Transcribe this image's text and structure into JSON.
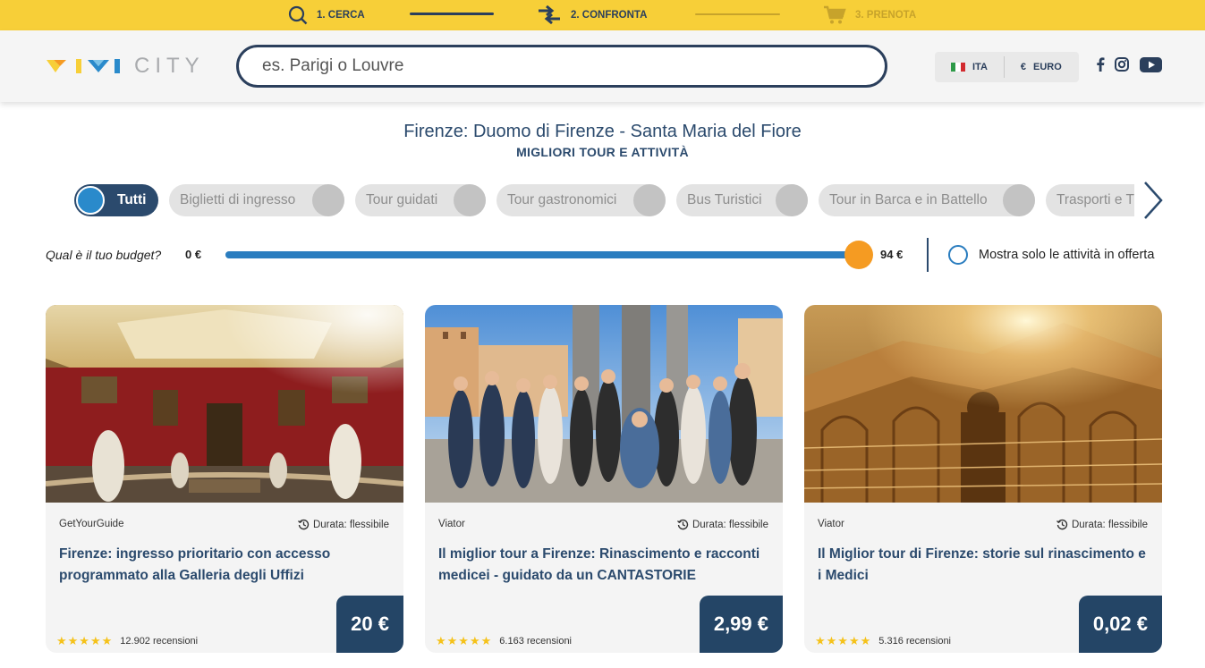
{
  "steps": [
    {
      "label": "1. CERCA",
      "icon": "search-icon"
    },
    {
      "label": "2. CONFRONTA",
      "icon": "compare-arrows-icon"
    },
    {
      "label": "3. PRENOTA",
      "icon": "cart-icon"
    }
  ],
  "header": {
    "logo_text": "CITY",
    "search_placeholder": "es. Parigi o Louvre",
    "language": "ITA",
    "currency_symbol": "€",
    "currency": "EURO",
    "social": [
      "facebook-icon",
      "instagram-icon",
      "youtube-icon"
    ]
  },
  "page": {
    "title": "Firenze: Duomo di Firenze - Santa Maria del Fiore",
    "subtitle": "MIGLIORI TOUR E ATTIVITÀ"
  },
  "filters": [
    {
      "label": "Tutti",
      "active": true
    },
    {
      "label": "Biglietti di ingresso",
      "active": false
    },
    {
      "label": "Tour guidati",
      "active": false
    },
    {
      "label": "Tour gastronomici",
      "active": false
    },
    {
      "label": "Bus Turistici",
      "active": false
    },
    {
      "label": "Tour in Barca e in Battello",
      "active": false
    },
    {
      "label": "Trasporti e Trasferimenti",
      "active": false
    }
  ],
  "budget": {
    "label": "Qual è il tuo budget?",
    "min": "0 €",
    "max": "94 €",
    "level": 1.0,
    "offer_label": "Mostra solo le attività in offerta"
  },
  "cards": [
    {
      "provider": "GetYourGuide",
      "duration": "Durata: flessibile",
      "title": "Firenze: ingresso prioritario con accesso programmato alla Galleria degli Uffizi",
      "stars": "★★★★★",
      "rating": 4.5,
      "reviews": "12.902 recensioni",
      "price": "20 €"
    },
    {
      "provider": "Viator",
      "duration": "Durata: flessibile",
      "title": "Il miglior tour a Firenze: Rinascimento e racconti medicei - guidato da un CANTASTORIE",
      "stars": "★★★★★",
      "rating": 5,
      "reviews": "6.163 recensioni",
      "price": "2,99 €"
    },
    {
      "provider": "Viator",
      "duration": "Durata: flessibile",
      "title": "Il Miglior tour di Firenze: storie sul rinascimento e i Medici",
      "stars": "★★★★★",
      "rating": 5,
      "reviews": "5.316 recensioni",
      "price": "0,02 €"
    }
  ],
  "colors": {
    "yellow": "#f7cf38",
    "navy": "#2b4a6d",
    "blue": "#2a7dbf",
    "orange": "#f59b22"
  }
}
